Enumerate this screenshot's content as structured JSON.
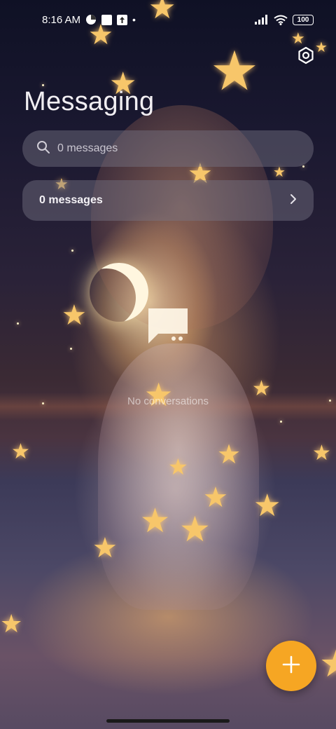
{
  "status_bar": {
    "time": "8:16 AM",
    "battery": "100"
  },
  "header": {
    "title": "Messaging"
  },
  "search": {
    "placeholder": "0 messages"
  },
  "filter": {
    "label": "0 messages"
  },
  "empty_state": {
    "text": "No conversations"
  },
  "colors": {
    "fab": "#f6a623",
    "card_background": "rgba(120,118,132,0.45)"
  },
  "icons": {
    "settings": "gear-icon",
    "search": "search-icon",
    "filter_chevron": "chevron-right-icon",
    "empty": "chat-bubble-icon",
    "fab": "plus-icon"
  }
}
